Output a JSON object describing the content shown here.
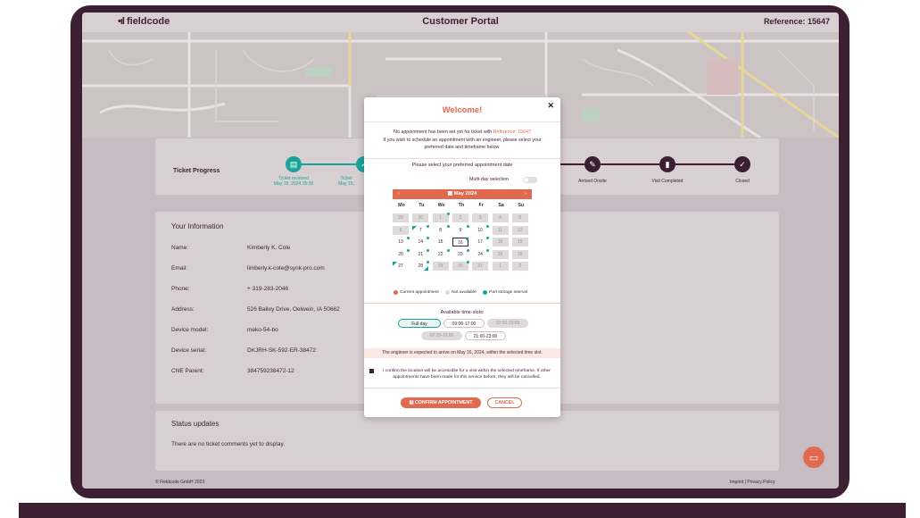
{
  "header": {
    "logo": "fieldcode",
    "title": "Customer Portal",
    "reference": "Reference: 15647"
  },
  "progress": {
    "label": "Ticket Progress",
    "steps": [
      {
        "label": "Ticket received",
        "date": "May 15, 2024 15:38",
        "state": "done"
      },
      {
        "label": "Ticket",
        "date": "May 15,",
        "state": "done"
      },
      {
        "label": "Arrived Onsite",
        "date": "",
        "state": "pending"
      },
      {
        "label": "Visit Completed",
        "date": "",
        "state": "pending"
      },
      {
        "label": "Closed",
        "date": "",
        "state": "pending"
      }
    ]
  },
  "info": {
    "title": "Your Information",
    "rows": [
      {
        "key": "Name:",
        "value": "Kimberly K. Cole"
      },
      {
        "key": "Email:",
        "value": "limberly.k-cole@synk-pro.com"
      },
      {
        "key": "Phone:",
        "value": "+ 319-283-2046"
      },
      {
        "key": "Address:",
        "value": "526 Bailey Drive, Oelwein, IA 50662"
      },
      {
        "key": "Device model:",
        "value": "meko-54-bo"
      },
      {
        "key": "Device serial:",
        "value": "DKJRH-SK-592-ER-38472"
      },
      {
        "key": "CNE Parent:",
        "value": "384759238472-12"
      }
    ]
  },
  "status": {
    "title": "Status updates",
    "text": "There are no ticket comments yet to display."
  },
  "footer": {
    "copyright": "© Fieldcode GmbH 2023",
    "links": "Imprint  |  Privacy Policy"
  },
  "modal": {
    "title": "Welcome!",
    "intro_before": "No appointment has been set yet for ticket with ",
    "intro_ref": "Reference: 15647",
    "intro_after": "If you wish to schedule an appointment with an engineer, please select your preferred date and timeframe below.",
    "select_prompt": "Please select your preferred appointment date",
    "multi_day": "Multi-day selection",
    "calendar": {
      "month": "May 2024",
      "weekdays": [
        "Mo",
        "Tu",
        "We",
        "Th",
        "Fr",
        "Sa",
        "Su"
      ],
      "weeks": [
        [
          "29",
          "30",
          "1",
          "2",
          "3",
          "4",
          "5"
        ],
        [
          "6",
          "7",
          "8",
          "9",
          "10",
          "11",
          "12"
        ],
        [
          "13",
          "14",
          "15",
          "16",
          "17",
          "18",
          "19"
        ],
        [
          "20",
          "21",
          "22",
          "23",
          "24",
          "25",
          "26"
        ],
        [
          "27",
          "28",
          "29",
          "30",
          "31",
          "1",
          "2"
        ]
      ]
    },
    "legend": [
      "Current appointment",
      "Not available",
      "Part storage interval"
    ],
    "legend_colors": {
      "current": "#e0694f",
      "not_available": "#dedadb",
      "part_storage": "#1aa39a"
    },
    "slots_title": "Available time-slots:",
    "slots": [
      {
        "label": "Full day",
        "state": "active"
      },
      {
        "label": "09:00-17:00",
        "state": "normal"
      },
      {
        "label": "22:00-23:59",
        "state": "disabled"
      },
      {
        "label": "07:20-10:00",
        "state": "disabled"
      },
      {
        "label": "21:00-23:00",
        "state": "normal"
      }
    ],
    "notice": "The engineer is expected to arrive on May 16, 2024, within the selected time slot.",
    "confirm_text": "I confirm the location will be accessible for a visit within the selected timeframe. If other appointments have been made for this service before, they will be cancelled.",
    "confirm_button": "CONFIRM APPOINTMENT",
    "cancel_button": "CANCEL"
  },
  "colors": {
    "accent": "#e0694f",
    "teal": "#1aa39a",
    "dark": "#3c1f33"
  }
}
